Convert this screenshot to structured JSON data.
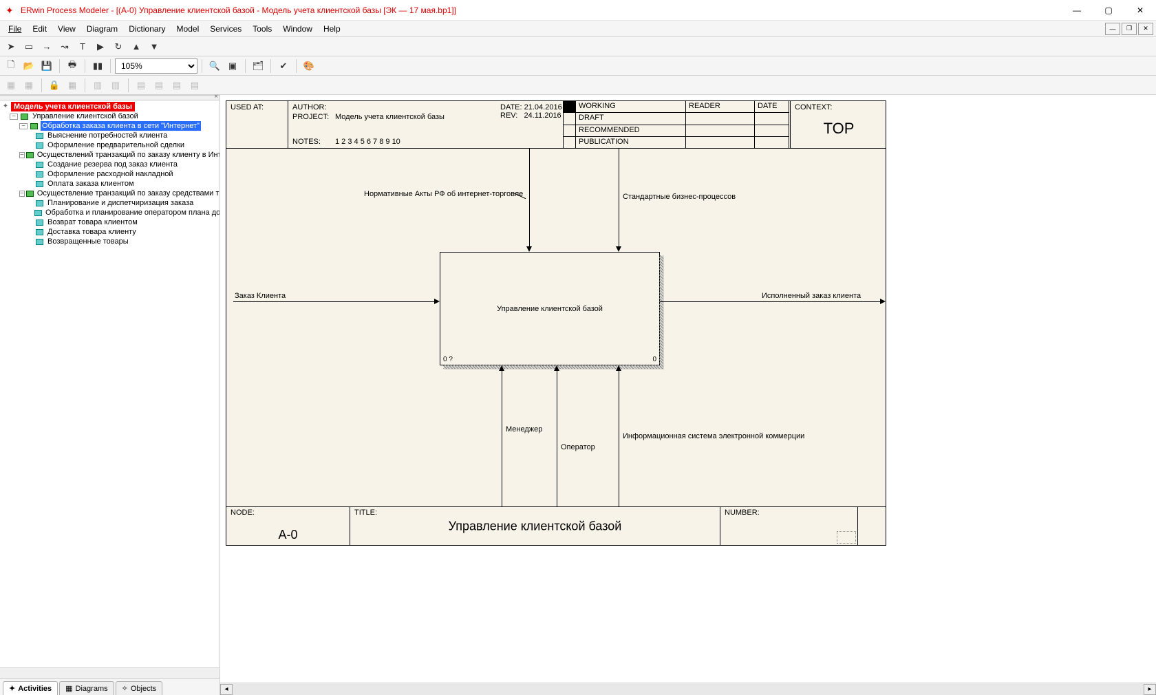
{
  "titlebar": {
    "app": "ERwin Process Modeler - [(A-0) Управление клиентской базой - Модель учета клиентской базы  [ЭК — 17 мая.bp1]]"
  },
  "menu": {
    "file": "File",
    "edit": "Edit",
    "view": "View",
    "diagram": "Diagram",
    "dictionary": "Dictionary",
    "model": "Model",
    "services": "Services",
    "tools": "Tools",
    "window": "Window",
    "help": "Help"
  },
  "toolbar": {
    "zoom": "105%"
  },
  "tree": {
    "root": "Модель учета клиентской базы",
    "n1": "Управление клиентской базой",
    "n1_1": "Обработка заказа клиента в сети \"Интернет\"",
    "n1_1_1": "Выяснение потребностей клиента",
    "n1_1_2": "Оформление предварительной сделки",
    "n1_2": "Осуществлений транзакций по заказу клиенту в Интранет",
    "n1_2_1": "Создание резерва под заказ клиента",
    "n1_2_2": "Оформление расходной накладной",
    "n1_2_3": "Оплата заказа клиентом",
    "n1_3": "Осуществление транзакций по заказу средствами трасп",
    "n1_3_1": "Планирование и диспетчиризация заказа",
    "n1_3_2": "Обработка и планирование оператором плана достав",
    "n1_3_3": "Возврат товара клиентом",
    "n1_3_4": "Доставка товара клиенту",
    "n1_3_5": "Возвращенные товары"
  },
  "tabs": {
    "activities": "Activities",
    "diagrams": "Diagrams",
    "objects": "Objects"
  },
  "idef0_header": {
    "used_at": "USED AT:",
    "author_label": "AUTHOR:",
    "project_label": "PROJECT:",
    "project_value": "Модель учета клиентской базы",
    "date_label": "DATE:",
    "date_value": "21.04.2016",
    "rev_label": "REV:",
    "rev_value": "24.11.2016",
    "notes_label": "NOTES:",
    "notes_value": "1 2 3 4 5 6 7 8 9 10",
    "working": "WORKING",
    "draft": "DRAFT",
    "recommended": "RECOMMENDED",
    "publication": "PUBLICATION",
    "reader": "READER",
    "reader_date": "DATE",
    "context_label": "CONTEXT:",
    "context_top": "TOP"
  },
  "diagram": {
    "input": "Заказ Клиента",
    "output": "Исполненный заказ клиента",
    "control1": "Нормативные Акты РФ об интернет-торговле",
    "control2": "Стандартные бизнес-процессов",
    "mech1": "Менеджер",
    "mech2": "Оператор",
    "mech3": "Информационная система электронной коммерции",
    "process": "Управление клиентской базой",
    "corner_left": "0 ?",
    "corner_right": "0"
  },
  "idef0_footer": {
    "node_label": "NODE:",
    "node_value": "A-0",
    "title_label": "TITLE:",
    "title_value": "Управление клиентской базой",
    "number_label": "NUMBER:"
  }
}
